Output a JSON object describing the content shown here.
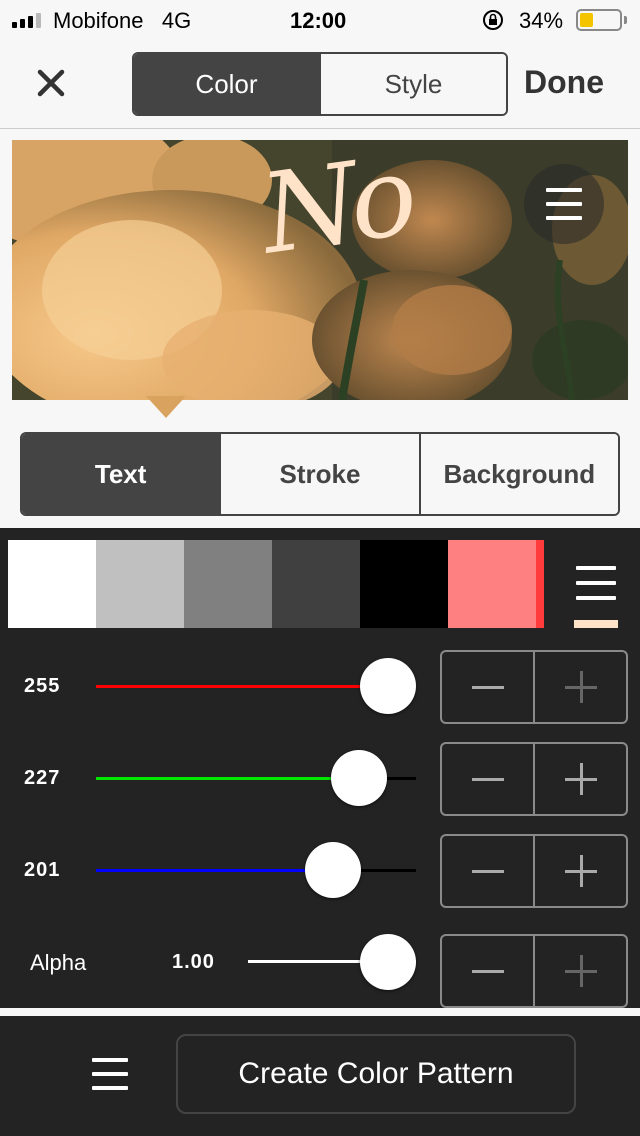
{
  "status_bar": {
    "carrier": "Mobifone",
    "network": "4G",
    "time": "12:00",
    "battery_percent": "34%",
    "battery_level": 0.34,
    "icons": [
      "signal-icon",
      "rotation-lock-icon",
      "battery-icon"
    ]
  },
  "nav": {
    "close_icon": "close-icon",
    "tabs": [
      {
        "label": "Color",
        "active": true
      },
      {
        "label": "Style",
        "active": false
      }
    ],
    "done_label": "Done"
  },
  "preview": {
    "text": "No",
    "menu_icon": "menu-icon"
  },
  "target_tabs": [
    {
      "label": "Text",
      "active": true
    },
    {
      "label": "Stroke",
      "active": false
    },
    {
      "label": "Background",
      "active": false
    }
  ],
  "palette": {
    "swatches": [
      "#ffffff",
      "#c0c0c0",
      "#808080",
      "#404040",
      "#000000",
      "#ff8080"
    ],
    "selected_index": 5,
    "accent": "#ff3b3b",
    "current_color": "#ffe3c9",
    "menu_icon": "menu-icon"
  },
  "sliders": [
    {
      "name": "red",
      "value": "255",
      "fraction": 1.0,
      "color": "#ff0000"
    },
    {
      "name": "green",
      "value": "227",
      "fraction": 0.89,
      "color": "#00e600"
    },
    {
      "name": "blue",
      "value": "201",
      "fraction": 0.79,
      "color": "#0000ff"
    }
  ],
  "alpha": {
    "label": "Alpha",
    "value": "1.00",
    "fraction": 1.0
  },
  "bottom": {
    "menu_icon": "menu-icon",
    "create_pattern_label": "Create Color Pattern"
  }
}
